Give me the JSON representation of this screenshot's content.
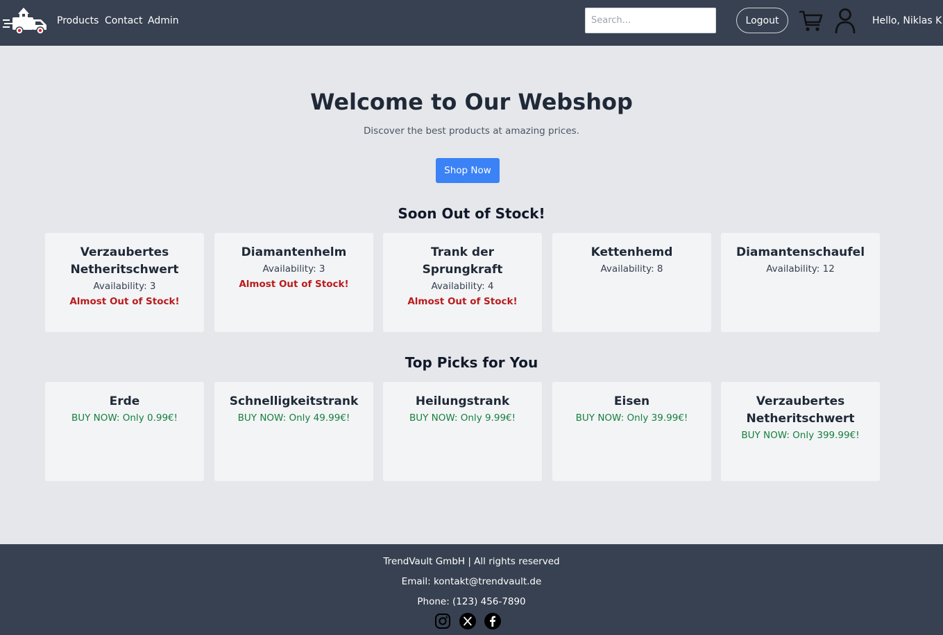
{
  "header": {
    "nav": [
      "Products",
      "Contact",
      "Admin"
    ],
    "search_placeholder": "Search...",
    "logout_label": "Logout",
    "greeting": "Hello, Niklas K!"
  },
  "hero": {
    "title": "Welcome to Our Webshop",
    "subtitle": "Discover the best products at amazing prices.",
    "button": "Shop Now"
  },
  "soon_out": {
    "title": "Soon Out of Stock!",
    "items": [
      {
        "name": "Verzaubertes Netheritschwert",
        "availability": "Availability: 3",
        "warning": "Almost Out of Stock!"
      },
      {
        "name": "Diamantenhelm",
        "availability": "Availability: 3",
        "warning": "Almost Out of Stock!"
      },
      {
        "name": "Trank der Sprungkraft",
        "availability": "Availability: 4",
        "warning": "Almost Out of Stock!"
      },
      {
        "name": "Kettenhemd",
        "availability": "Availability: 8",
        "warning": ""
      },
      {
        "name": "Diamantenschaufel",
        "availability": "Availability: 12",
        "warning": ""
      }
    ]
  },
  "top_picks": {
    "title": "Top Picks for You",
    "items": [
      {
        "name": "Erde",
        "price": "BUY NOW: Only 0.99€!"
      },
      {
        "name": "Schnelligkeitstrank",
        "price": "BUY NOW: Only 49.99€!"
      },
      {
        "name": "Heilungstrank",
        "price": "BUY NOW: Only 9.99€!"
      },
      {
        "name": "Eisen",
        "price": "BUY NOW: Only 39.99€!"
      },
      {
        "name": "Verzaubertes Netheritschwert",
        "price": "BUY NOW: Only 399.99€!"
      }
    ]
  },
  "footer": {
    "company": "TrendVault GmbH | All rights reserved",
    "email": "Email: kontakt@trendvault.de",
    "phone": "Phone: (123) 456-7890",
    "social": [
      "instagram-icon",
      "x-icon",
      "facebook-icon"
    ]
  },
  "colors": {
    "header_bg": "#374151",
    "page_bg": "#e5e7eb",
    "card_bg": "#f3f4f6",
    "accent": "#3b82f6",
    "warning": "#b91c1c",
    "price": "#15803d"
  }
}
